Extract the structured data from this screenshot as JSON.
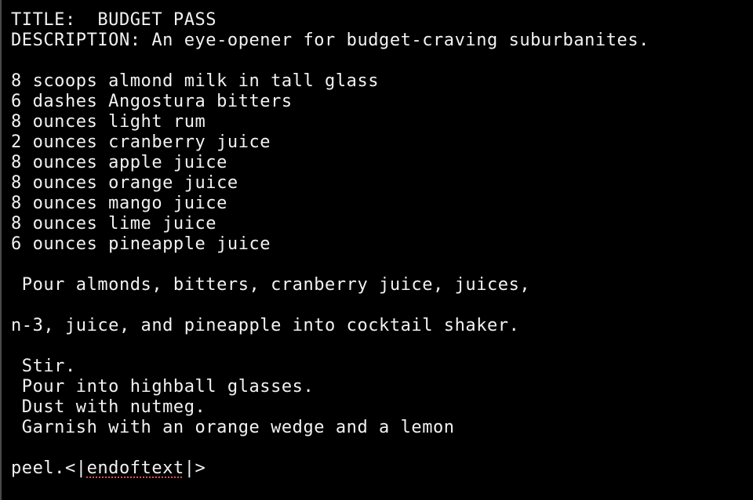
{
  "terminal": {
    "lines": [
      "TITLE:  BUDGET PASS",
      "DESCRIPTION: An eye-opener for budget-craving suburbanites.",
      "8 scoops almond milk in tall glass",
      "6 dashes Angostura bitters",
      "8 ounces light rum",
      "2 ounces cranberry juice",
      "8 ounces apple juice",
      "8 ounces orange juice",
      "8 ounces mango juice",
      "8 ounces lime juice",
      "6 ounces pineapple juice",
      " Pour almonds, bitters, cranberry juice, juices,",
      "n-3, juice, and pineapple into cocktail shaker.",
      " Stir.",
      " Pour into highball glasses.",
      " Dust with nutmeg.",
      " Garnish with an orange wedge and a lemon"
    ],
    "last_line": {
      "prefix": "peel.<|",
      "flagged_word": "endoftext",
      "suffix": "|>"
    }
  }
}
